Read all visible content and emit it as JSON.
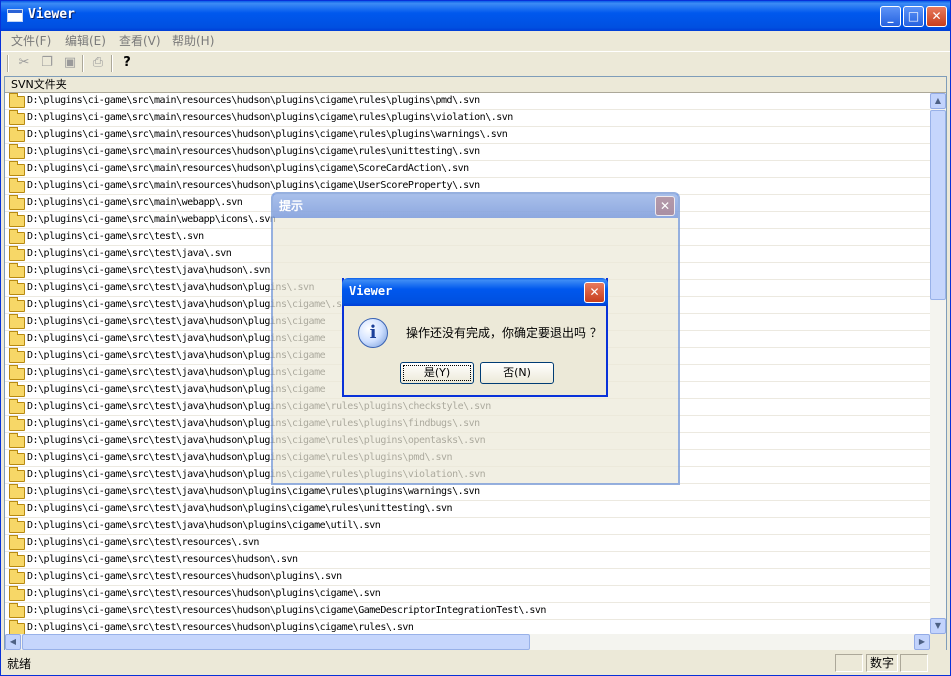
{
  "window": {
    "title": "Viewer"
  },
  "menu": [
    "文件(F)",
    "编辑(E)",
    "查看(V)",
    "帮助(H)"
  ],
  "toolbar": {
    "help_glyph": "?"
  },
  "list": {
    "header": "SVN文件夹",
    "rows": [
      "D:\\plugins\\ci-game\\src\\main\\resources\\hudson\\plugins\\cigame\\rules\\plugins\\pmd\\.svn",
      "D:\\plugins\\ci-game\\src\\main\\resources\\hudson\\plugins\\cigame\\rules\\plugins\\violation\\.svn",
      "D:\\plugins\\ci-game\\src\\main\\resources\\hudson\\plugins\\cigame\\rules\\plugins\\warnings\\.svn",
      "D:\\plugins\\ci-game\\src\\main\\resources\\hudson\\plugins\\cigame\\rules\\unittesting\\.svn",
      "D:\\plugins\\ci-game\\src\\main\\resources\\hudson\\plugins\\cigame\\ScoreCardAction\\.svn",
      "D:\\plugins\\ci-game\\src\\main\\resources\\hudson\\plugins\\cigame\\UserScoreProperty\\.svn",
      "D:\\plugins\\ci-game\\src\\main\\webapp\\.svn",
      "D:\\plugins\\ci-game\\src\\main\\webapp\\icons\\.svn",
      "D:\\plugins\\ci-game\\src\\test\\.svn",
      "D:\\plugins\\ci-game\\src\\test\\java\\.svn",
      "D:\\plugins\\ci-game\\src\\test\\java\\hudson\\.svn",
      "D:\\plugins\\ci-game\\src\\test\\java\\hudson\\plugins\\.svn",
      "D:\\plugins\\ci-game\\src\\test\\java\\hudson\\plugins\\cigame\\.svn",
      "D:\\plugins\\ci-game\\src\\test\\java\\hudson\\plugins\\cigame",
      "D:\\plugins\\ci-game\\src\\test\\java\\hudson\\plugins\\cigame",
      "D:\\plugins\\ci-game\\src\\test\\java\\hudson\\plugins\\cigame",
      "D:\\plugins\\ci-game\\src\\test\\java\\hudson\\plugins\\cigame",
      "D:\\plugins\\ci-game\\src\\test\\java\\hudson\\plugins\\cigame",
      "D:\\plugins\\ci-game\\src\\test\\java\\hudson\\plugins\\cigame\\rules\\plugins\\checkstyle\\.svn",
      "D:\\plugins\\ci-game\\src\\test\\java\\hudson\\plugins\\cigame\\rules\\plugins\\findbugs\\.svn",
      "D:\\plugins\\ci-game\\src\\test\\java\\hudson\\plugins\\cigame\\rules\\plugins\\opentasks\\.svn",
      "D:\\plugins\\ci-game\\src\\test\\java\\hudson\\plugins\\cigame\\rules\\plugins\\pmd\\.svn",
      "D:\\plugins\\ci-game\\src\\test\\java\\hudson\\plugins\\cigame\\rules\\plugins\\violation\\.svn",
      "D:\\plugins\\ci-game\\src\\test\\java\\hudson\\plugins\\cigame\\rules\\plugins\\warnings\\.svn",
      "D:\\plugins\\ci-game\\src\\test\\java\\hudson\\plugins\\cigame\\rules\\unittesting\\.svn",
      "D:\\plugins\\ci-game\\src\\test\\java\\hudson\\plugins\\cigame\\util\\.svn",
      "D:\\plugins\\ci-game\\src\\test\\resources\\.svn",
      "D:\\plugins\\ci-game\\src\\test\\resources\\hudson\\.svn",
      "D:\\plugins\\ci-game\\src\\test\\resources\\hudson\\plugins\\.svn",
      "D:\\plugins\\ci-game\\src\\test\\resources\\hudson\\plugins\\cigame\\.svn",
      "D:\\plugins\\ci-game\\src\\test\\resources\\hudson\\plugins\\cigame\\GameDescriptorIntegrationTest\\.svn",
      "D:\\plugins\\ci-game\\src\\test\\resources\\hudson\\plugins\\cigame\\rules\\.svn"
    ]
  },
  "ghost_dialog": {
    "title": "提示"
  },
  "message_box": {
    "title": "Viewer",
    "message": "操作还没有完成，你确定要退出吗 ？",
    "yes_label": "是(Y)",
    "no_label": "否(N)"
  },
  "status": {
    "text": "就绪",
    "pane_num": "数字"
  },
  "colors": {
    "title_blue": "#0058ee",
    "close_red": "#c73e1d",
    "face": "#ece9d8"
  }
}
